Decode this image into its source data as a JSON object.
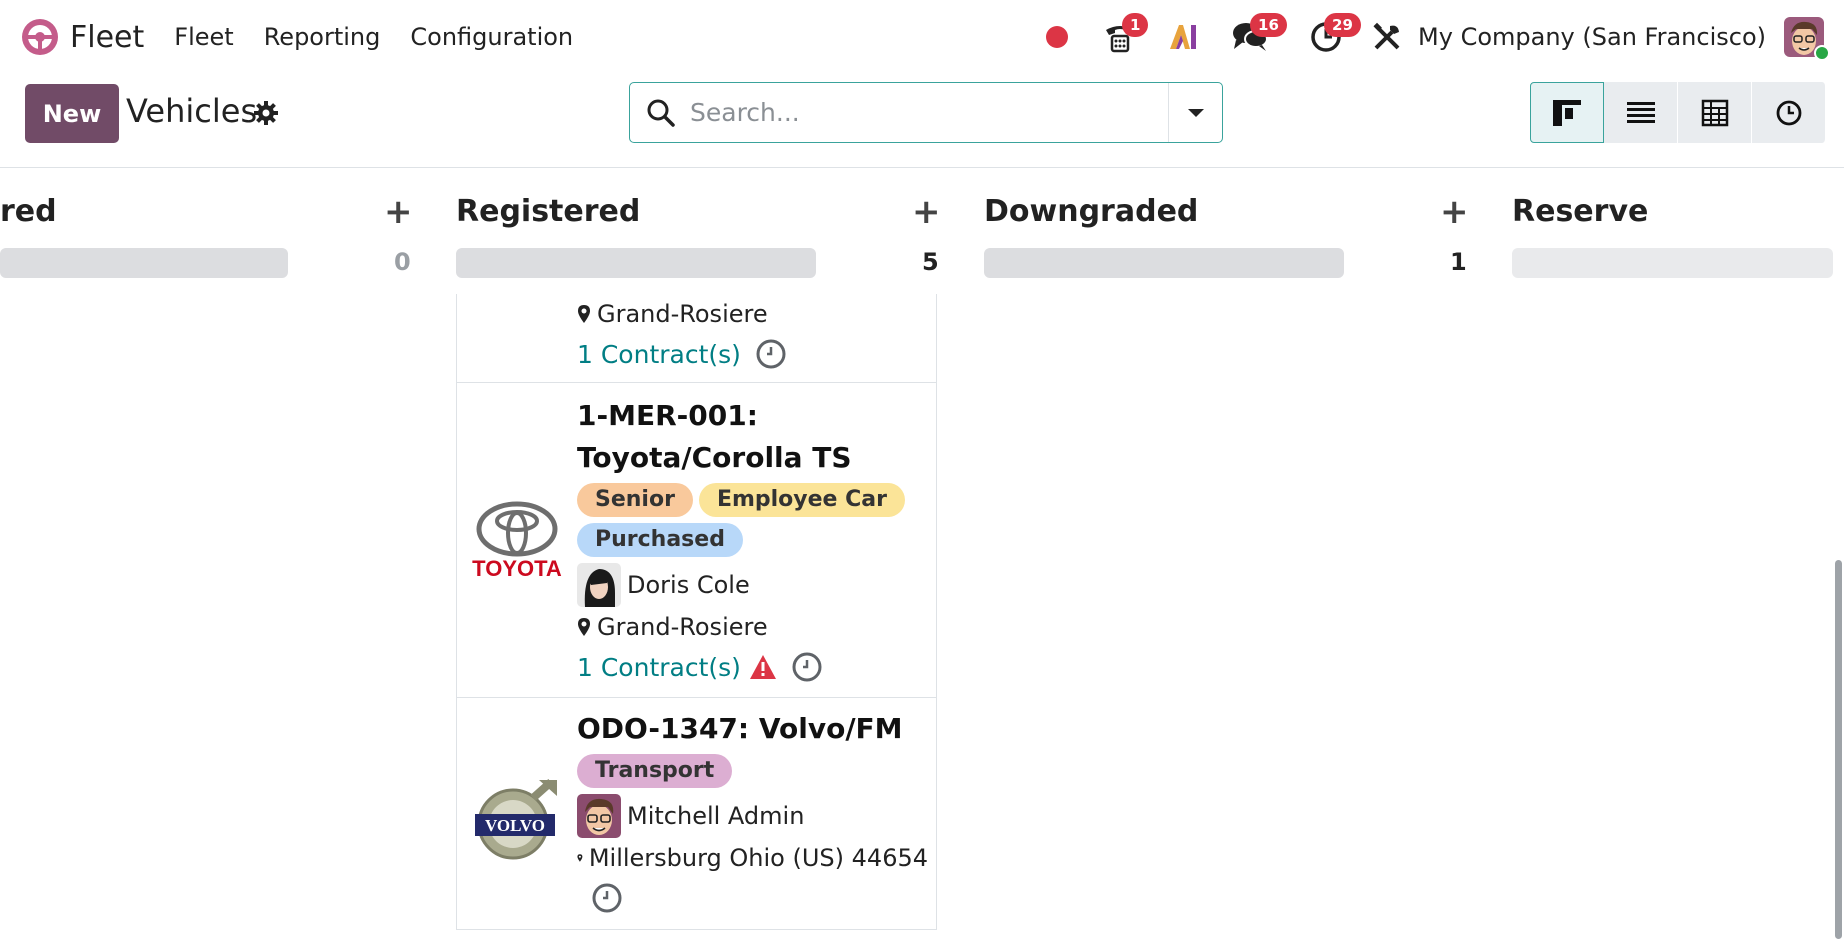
{
  "navbar": {
    "app_name": "Fleet",
    "menu": [
      "Fleet",
      "Reporting",
      "Configuration"
    ],
    "badges": {
      "calls": "1",
      "messages": "16",
      "activities": "29"
    },
    "company": "My Company (San Francisco)",
    "icons": [
      "recording-dot-icon",
      "phone-icon",
      "ai-icon",
      "chat-icon",
      "clock-icon",
      "tools-icon"
    ]
  },
  "control": {
    "new_label": "New",
    "title": "Vehicles",
    "search_placeholder": "Search..."
  },
  "views": [
    "kanban-view",
    "list-view",
    "pivot-view",
    "activity-view"
  ],
  "columns": [
    {
      "label": "red",
      "count": "0"
    },
    {
      "label": "Registered",
      "count": "5"
    },
    {
      "label": "Downgraded",
      "count": "1"
    },
    {
      "label": "Reserve",
      "count": ""
    }
  ],
  "cards": [
    {
      "location": "Grand-Rosiere",
      "contracts": "1 Contract(s)"
    },
    {
      "title_line1": "1-MER-001:",
      "title_line2": "Toyota/Corolla TS",
      "brand_text": "TOYOTA",
      "tags": [
        "Senior",
        "Employee Car",
        "Purchased"
      ],
      "driver": "Doris Cole",
      "location": "Grand-Rosiere",
      "contracts": "1 Contract(s)"
    },
    {
      "title": "ODO-1347: Volvo/FM",
      "brand_text": "VOLVO",
      "tags": [
        "Transport"
      ],
      "driver": "Mitchell Admin",
      "location": "Millersburg Ohio (US) 44654"
    }
  ],
  "colors": {
    "brand": "#714b67",
    "accent": "#017e84",
    "danger": "#dc3545",
    "tag_senior": "#f9c99c",
    "tag_employee": "#fbe498",
    "tag_purchased": "#b8d8f9",
    "tag_transport": "#dcaed2"
  }
}
